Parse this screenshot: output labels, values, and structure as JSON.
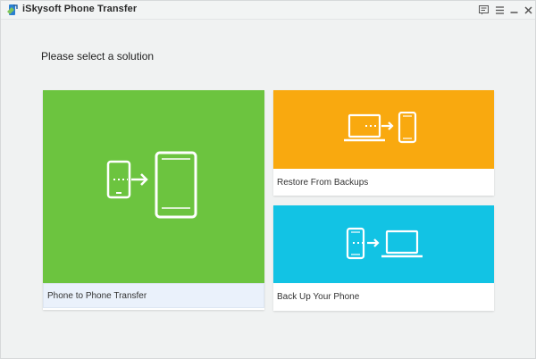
{
  "window": {
    "title": "iSkysoft Phone Transfer",
    "controls": [
      "feedback-icon",
      "menu-icon",
      "minimize-icon",
      "close-icon"
    ]
  },
  "main": {
    "heading": "Please select a solution",
    "tiles": [
      {
        "label": "Phone to Phone Transfer",
        "color": "#6cc43f",
        "icon": "phone-to-phone-icon",
        "selected": true
      },
      {
        "label": "Restore From Backups",
        "color": "#f9a90f",
        "icon": "laptop-to-phone-icon"
      },
      {
        "label": "Back Up Your Phone",
        "color": "#12c3e4",
        "icon": "phone-to-laptop-icon"
      }
    ]
  }
}
